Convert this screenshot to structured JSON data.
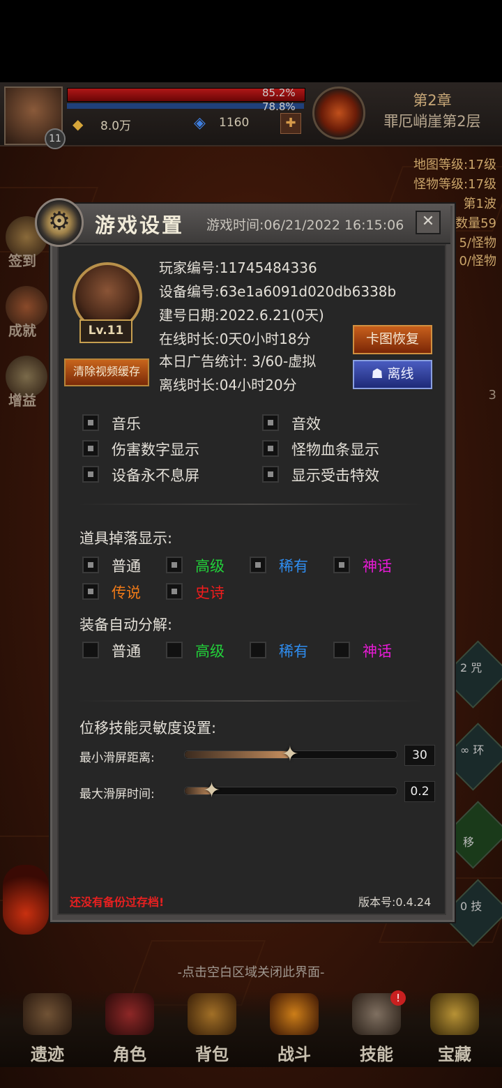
{
  "hud": {
    "level": "11",
    "hp_pct": "85.2%",
    "mp_pct": "78.8%",
    "gold": "8.0万",
    "gems": "1160",
    "chapter": "第2章",
    "stage": "罪厄峭崖第2层"
  },
  "side_right": {
    "map_level": "地图等级:17级",
    "monster_level": "怪物等级:17级",
    "wave": "第1波",
    "count": "数量59",
    "per1": "5/怪物",
    "per2": "0/怪物",
    "num": "3"
  },
  "side_left": {
    "signin": "签到",
    "achievement": "成就",
    "buff": "增益"
  },
  "side_right_skills": [
    "2 咒",
    "∞ 环",
    "移",
    "0 技"
  ],
  "panel": {
    "title": "游戏设置",
    "game_time": "游戏时间:06/21/2022 16:15:06",
    "close": "✕",
    "level_badge": "Lv.11",
    "clear_cache": "清除视频缓存",
    "player_id": "玩家编号:11745484336",
    "device_id": "设备编号:63e1a6091d020db6338b",
    "created": "建号日期:2022.6.21(0天)",
    "online": "在线时长:0天0小时18分",
    "ads": "本日广告统计: 3/60-虚拟",
    "offline_time": "离线时长:04小时20分",
    "btn_restore": "卡图恢复",
    "btn_offline": "离线",
    "toggles": {
      "music": "音乐",
      "sfx": "音效",
      "damage_numbers": "伤害数字显示",
      "monster_hp": "怪物血条显示",
      "screen_on": "设备永不息屏",
      "hit_effect": "显示受击特效"
    },
    "drop_title": "道具掉落显示:",
    "drop": {
      "common": "普通",
      "advanced": "高级",
      "rare": "稀有",
      "myth": "神话",
      "legend": "传说",
      "epic": "史诗"
    },
    "decompose_title": "装备自动分解:",
    "decompose": {
      "common": "普通",
      "advanced": "高级",
      "rare": "稀有",
      "myth": "神话"
    },
    "sensitivity_title": "位移技能灵敏度设置:",
    "min_swipe_label": "最小滑屏距离:",
    "min_swipe_value": "30",
    "min_swipe_fraction": 0.5,
    "max_time_label": "最大滑屏时间:",
    "max_time_value": "0.2",
    "max_time_fraction": 0.13,
    "warning": "还没有备份过存档!",
    "version": "版本号:0.4.24"
  },
  "close_hint": "-点击空白区域关闭此界面-",
  "nav": [
    "遗迹",
    "角色",
    "背包",
    "战斗",
    "技能",
    "宝藏"
  ],
  "nav_badge": "!",
  "colors": {
    "common": "#e4e0d8",
    "advanced": "#22d13a",
    "rare": "#2f8df0",
    "myth": "#e81ad6",
    "legend": "#f07a18",
    "epic": "#f01c1c"
  }
}
